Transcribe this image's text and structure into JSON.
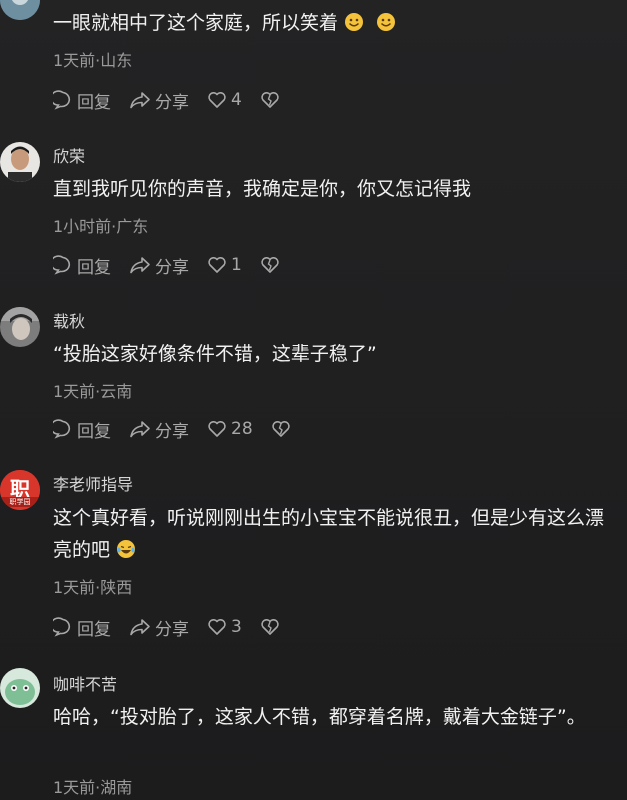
{
  "comments": [
    {
      "username": "",
      "text": "一眼就相中了这个家庭，所以笑着",
      "meta": "1天前·山东",
      "reply": "回复",
      "share": "分享",
      "likes": "4"
    },
    {
      "username": "欣荣",
      "text": "直到我听见你的声音，我确定是你，你又怎记得我",
      "meta": "1小时前·广东",
      "reply": "回复",
      "share": "分享",
      "likes": "1"
    },
    {
      "username": "载秋",
      "text": "“投胎这家好像条件不错，这辈子稳了”",
      "meta": "1天前·云南",
      "reply": "回复",
      "share": "分享",
      "likes": "28"
    },
    {
      "username": "李老师指导",
      "avatar_text": "职",
      "avatar_subtext": "职学园",
      "text": "这个真好看，听说刚刚出生的小宝宝不能说很丑，但是少有这么漂亮的吧",
      "meta": "1天前·陕西",
      "reply": "回复",
      "share": "分享",
      "likes": "3"
    },
    {
      "username": "咖啡不苦",
      "text": "哈哈，“投对胎了，这家人不错，都穿着名牌，戴着大金链子”。",
      "meta": "1天前·湖南"
    }
  ],
  "icons": {
    "reply": "speech-bubble-icon",
    "share": "share-arrow-icon",
    "like": "heart-icon",
    "dislike": "broken-heart-icon",
    "emoji_smile": "smile-emoji-icon",
    "emoji_laugh": "laugh-cry-emoji-icon"
  },
  "colors": {
    "background": "#1e1e1f",
    "text": "#f1f1f1",
    "meta": "#9a9a9a",
    "action": "#a8a8a8"
  }
}
